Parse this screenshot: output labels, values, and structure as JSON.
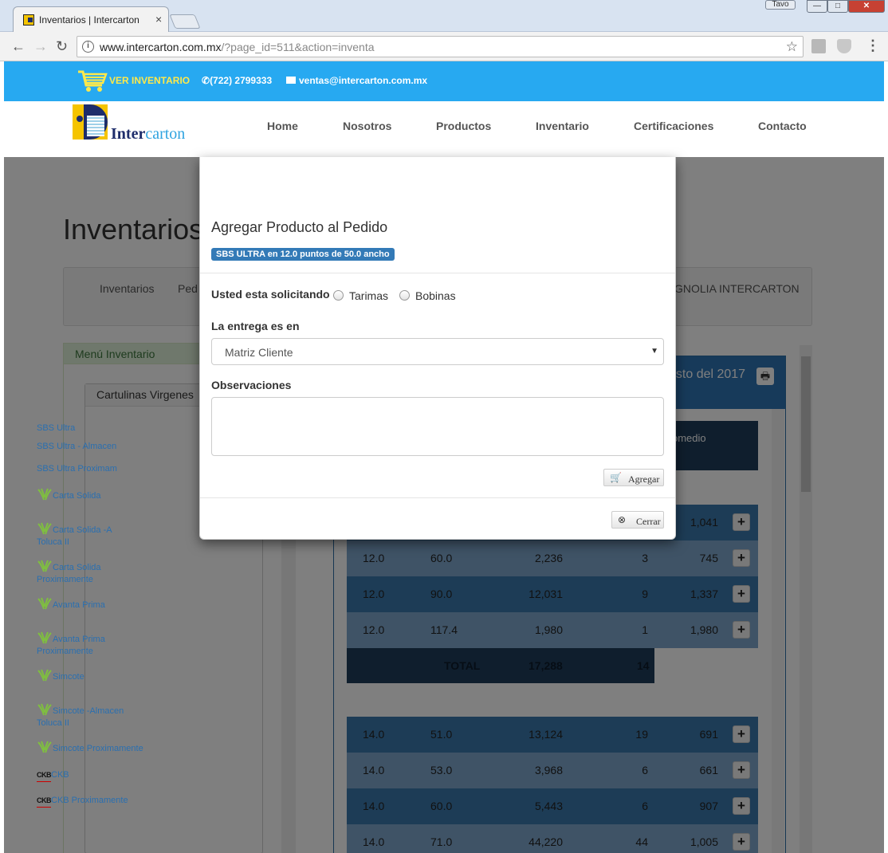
{
  "browser": {
    "tab_title": "Inventarios | Intercarton",
    "tab_close": "×",
    "user_name": "Tavo",
    "url_host": "www.intercarton.com.mx",
    "url_path": "/?page_id=511&action=inventa",
    "info": "i",
    "star": "☆",
    "back": "←",
    "forward": "→",
    "reload": "↻",
    "menu": "⋮",
    "win_min": "—",
    "win_max": "□",
    "win_close": "✕"
  },
  "topbar": {
    "cart_label": "VER INVENTARIO",
    "phone": "(722) 2799333",
    "email": "ventas@intercarton.com.mx",
    "accent": "#27a9f1",
    "cart_color": "#ffe94a"
  },
  "logo": {
    "text_a": "Inter",
    "text_b": "carton"
  },
  "nav": [
    "Home",
    "Nosotros",
    "Productos",
    "Inventario",
    "Certificaciones",
    "Contacto"
  ],
  "page": {
    "title": "Inventarios",
    "panel_left": "Inventarios",
    "panel_mid": "Ped",
    "panel_right": "GNOLIA INTERCARTON",
    "menu_head": "Menú Inventario",
    "submenu_head": "Cartulinas Virgenes",
    "menu_items": [
      {
        "label": "SBS Ultra",
        "icon": "none"
      },
      {
        "label": "SBS Ultra - Almacen",
        "icon": "none"
      },
      {
        "label": "SBS Ultra Proximam",
        "icon": "none"
      },
      {
        "label": "Carta Solida",
        "icon": "leaf"
      },
      {
        "label": "Carta Solida -A",
        "sub": "Toluca II",
        "icon": "leaf"
      },
      {
        "label": "Carta Solida",
        "sub": "Proximamente",
        "icon": "leaf"
      },
      {
        "label": "Avanta Prima",
        "icon": "leaf"
      },
      {
        "label": "Avanta Prima",
        "sub": "Proximamente",
        "icon": "leaf"
      },
      {
        "label": "Simcote",
        "icon": "leaf"
      },
      {
        "label": "Simcote -Almacen",
        "sub": "Toluca II",
        "icon": "leaf"
      },
      {
        "label": "Simcote Proximamente",
        "icon": "leaf"
      },
      {
        "label": "CKB",
        "icon": "ckb"
      },
      {
        "label": "CKB Proximamente",
        "icon": "ckb"
      }
    ],
    "ckb_badge": "CKB",
    "results_title": "osto del 2017",
    "print_icon": "🖶",
    "table_head_col": "omedio",
    "rows_top": [
      {
        "a": "",
        "b": "",
        "c": "",
        "d": "",
        "e": "1,041"
      },
      {
        "a": "12.0",
        "b": "60.0",
        "c": "2,236",
        "d": "3",
        "e": "745"
      },
      {
        "a": "12.0",
        "b": "90.0",
        "c": "12,031",
        "d": "9",
        "e": "1,337"
      },
      {
        "a": "12.0",
        "b": "117.4",
        "c": "1,980",
        "d": "1",
        "e": "1,980"
      }
    ],
    "total": {
      "label": "TOTAL",
      "value": "17,288",
      "count": "14"
    },
    "rows_bottom": [
      {
        "a": "14.0",
        "b": "51.0",
        "c": "13,124",
        "d": "19",
        "e": "691"
      },
      {
        "a": "14.0",
        "b": "53.0",
        "c": "3,968",
        "d": "6",
        "e": "661"
      },
      {
        "a": "14.0",
        "b": "60.0",
        "c": "5,443",
        "d": "6",
        "e": "907"
      },
      {
        "a": "14.0",
        "b": "71.0",
        "c": "44,220",
        "d": "44",
        "e": "1,005"
      }
    ],
    "plus": "+"
  },
  "modal": {
    "title": "Agregar Producto al Pedido",
    "badge": "SBS ULTRA en 12.0 puntos de 50.0 ancho",
    "solicitando_label": "Usted esta solicitando",
    "option_tarimas": "Tarimas",
    "option_bobinas": "Bobinas",
    "entrega_label": "La entrega es en",
    "entrega_value": "Matriz Cliente",
    "select_arrow": "▼",
    "observaciones_label": "Observaciones",
    "observaciones_value": "",
    "agregar_button": "Agregar",
    "agregar_icon": "🛒",
    "cerrar_button": "Cerrar",
    "cerrar_icon": "⊗"
  }
}
